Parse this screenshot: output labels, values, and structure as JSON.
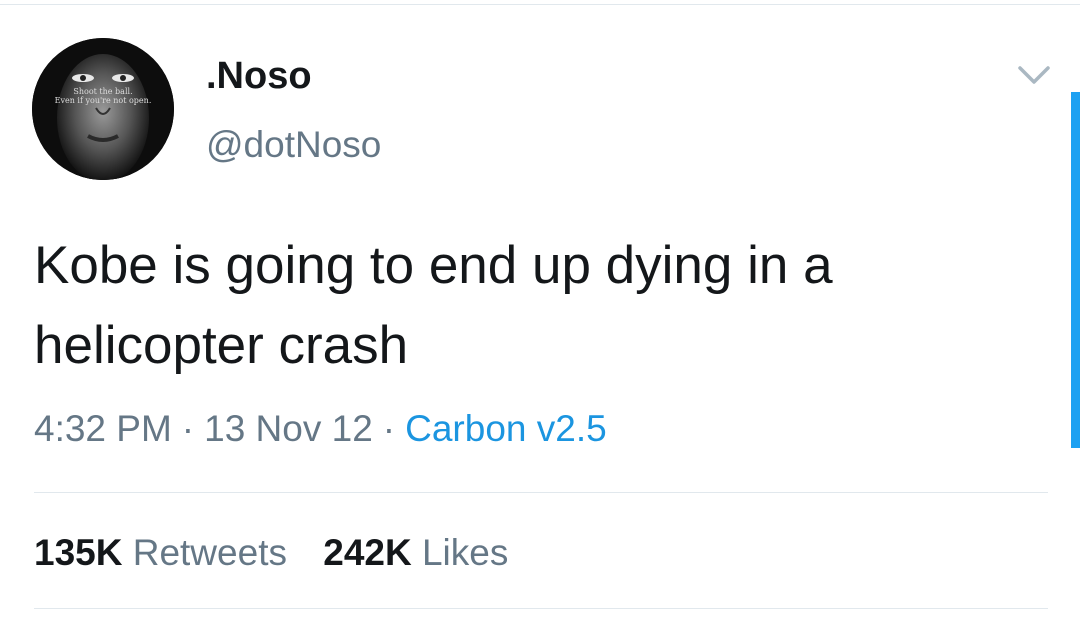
{
  "user": {
    "display_name": ".Noso",
    "handle": "@dotNoso",
    "avatar_caption_line1": "Shoot the ball.",
    "avatar_caption_line2": "Even if you're not open."
  },
  "tweet": {
    "text": "Kobe is going to end up dying in a helicopter crash",
    "time": "4:32 PM",
    "date": "13 Nov 12",
    "source": "Carbon v2.5",
    "separator": "·"
  },
  "stats": {
    "retweets_count": "135K",
    "retweets_label": "Retweets",
    "likes_count": "242K",
    "likes_label": "Likes"
  },
  "icons": {
    "menu": "chevron-down-icon"
  },
  "colors": {
    "text": "#14171a",
    "secondary": "#657786",
    "link": "#1b95e0",
    "accent": "#1da1f2",
    "divider": "#e1e8ed"
  }
}
